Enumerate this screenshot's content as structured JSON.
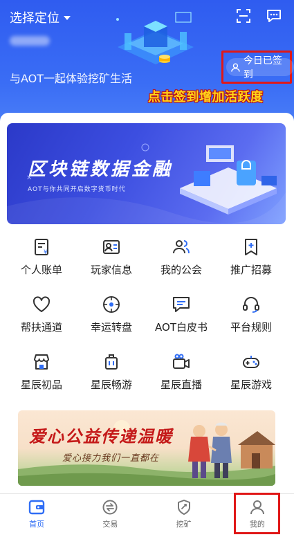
{
  "header": {
    "location_label": "选择定位",
    "slogan": "与AOT一起体验挖矿生活",
    "checkin_label": "今日已签到",
    "annotation": "点击签到增加活跃度"
  },
  "banner": {
    "title": "区块链数据金融",
    "subtitle": "AOT与你共同开启数字货币时代"
  },
  "grid": {
    "items": [
      {
        "label": "个人账单",
        "icon": "bill-icon"
      },
      {
        "label": "玩家信息",
        "icon": "player-card-icon"
      },
      {
        "label": "我的公会",
        "icon": "guild-icon"
      },
      {
        "label": "推广招募",
        "icon": "bookmark-plus-icon"
      },
      {
        "label": "帮扶通道",
        "icon": "heart-icon"
      },
      {
        "label": "幸运转盘",
        "icon": "wheel-icon"
      },
      {
        "label": "AOT白皮书",
        "icon": "chat-doc-icon"
      },
      {
        "label": "平台规则",
        "icon": "headset-icon"
      },
      {
        "label": "星辰初品",
        "icon": "shop-icon"
      },
      {
        "label": "星辰畅游",
        "icon": "luggage-icon"
      },
      {
        "label": "星辰直播",
        "icon": "video-camera-icon"
      },
      {
        "label": "星辰游戏",
        "icon": "gamepad-icon"
      }
    ]
  },
  "charity": {
    "title": "爱心公益传递温暖",
    "subtitle": "爱心接力我们一直都在"
  },
  "tabbar": {
    "items": [
      {
        "label": "首页",
        "active": true
      },
      {
        "label": "交易",
        "active": false
      },
      {
        "label": "挖矿",
        "active": false
      },
      {
        "label": "我的",
        "active": false
      }
    ]
  },
  "colors": {
    "primary": "#2f6df5",
    "header": "#3a6df5",
    "annotation": "#ffd51a",
    "highlight_box": "#e01818"
  }
}
